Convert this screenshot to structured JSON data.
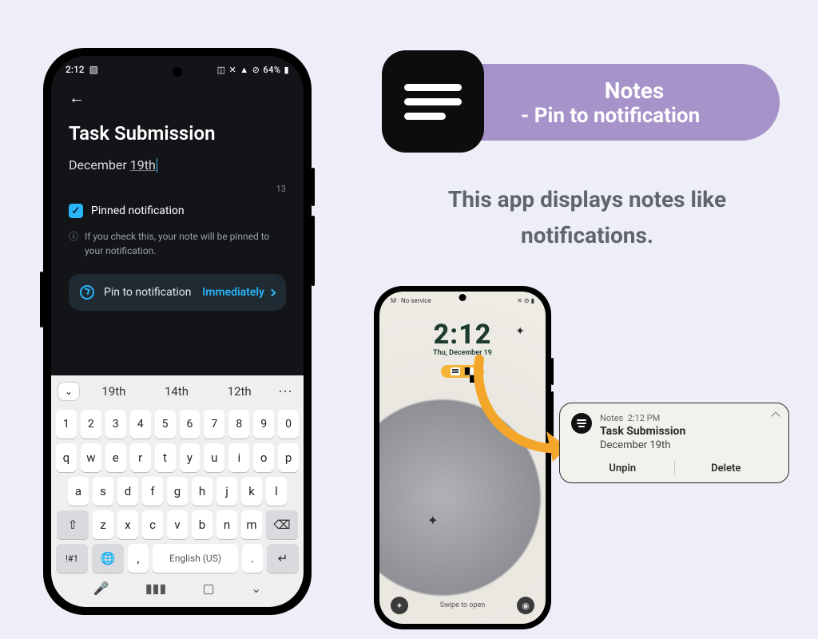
{
  "header": {
    "title": "Notes",
    "subtitle": "- Pin to notification"
  },
  "tagline": "This app displays notes like notifications.",
  "phone1": {
    "status_time": "2:12",
    "status_battery": "64%",
    "note_title": "Task Submission",
    "note_body_prefix": "December ",
    "note_body_underlined": "19th",
    "char_count": "13",
    "pinned_checkbox_label": "Pinned notification",
    "helper_text": "If you check this, your note will be pinned to your notification.",
    "pin_card_label": "Pin to notification",
    "pin_card_value": "Immediately",
    "keyboard": {
      "suggestions": [
        "19th",
        "14th",
        "12th"
      ],
      "row_num": [
        "1",
        "2",
        "3",
        "4",
        "5",
        "6",
        "7",
        "8",
        "9",
        "0"
      ],
      "row1": [
        "q",
        "w",
        "e",
        "r",
        "t",
        "y",
        "u",
        "i",
        "o",
        "p"
      ],
      "row2": [
        "a",
        "s",
        "d",
        "f",
        "g",
        "h",
        "j",
        "k",
        "l"
      ],
      "row3": [
        "z",
        "x",
        "c",
        "v",
        "b",
        "n",
        "m"
      ],
      "symbol_key": "!#1",
      "lang_label": "English (US)"
    }
  },
  "lockscreen": {
    "carrier": "M · No service",
    "time": "2:12",
    "date": "Thu, December 19",
    "swipe": "Swipe to open"
  },
  "notification": {
    "app": "Notes",
    "time": "2:12 PM",
    "title": "Task Submission",
    "body": "December 19th",
    "action_unpin": "Unpin",
    "action_delete": "Delete"
  }
}
